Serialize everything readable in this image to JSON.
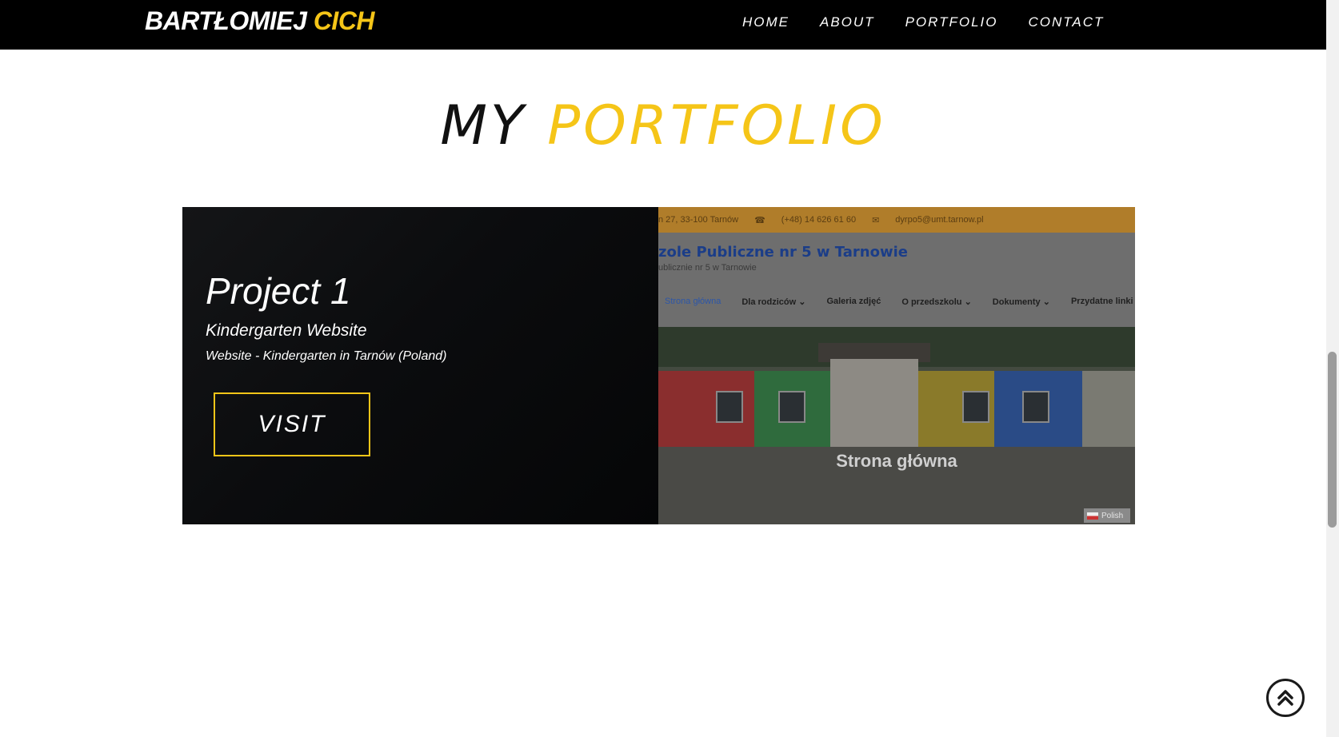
{
  "header": {
    "brand_first": "BARTŁOMIEJ",
    "brand_second": "CICH",
    "nav": [
      "HOME",
      "ABOUT",
      "PORTFOLIO",
      "CONTACT"
    ]
  },
  "section": {
    "title_first": "MY",
    "title_second": "PORTFOLIO"
  },
  "project": {
    "title": "Project 1",
    "subtitle": "Kindergarten Website",
    "description": "Website - Kindergarten in Tarnów (Poland)",
    "button_label": "VISIT",
    "preview": {
      "address": "n 27, 33-100 Tarnów",
      "phone": "(+48) 14 626 61 60",
      "email": "dyrpo5@umt.tarnow.pl",
      "site_title": "zole Publiczne nr 5 w Tarnowie",
      "site_subtitle": "ublicznie nr 5 w Tarnowie",
      "menu": [
        "Strona główna",
        "Dla rodziców ⌄",
        "Galeria zdjęć",
        "O przedszkolu ⌄",
        "Dokumenty ⌄",
        "Przydatne linki"
      ],
      "caption": "Strona główna",
      "language": "Polish"
    }
  },
  "icons": {
    "back_to_top": "double-chevron-up-icon",
    "phone": "phone-icon",
    "email": "envelope-icon"
  },
  "colors": {
    "accent": "#f5c518",
    "header_bg": "#000000",
    "card_bg": "#0c0d0f"
  }
}
